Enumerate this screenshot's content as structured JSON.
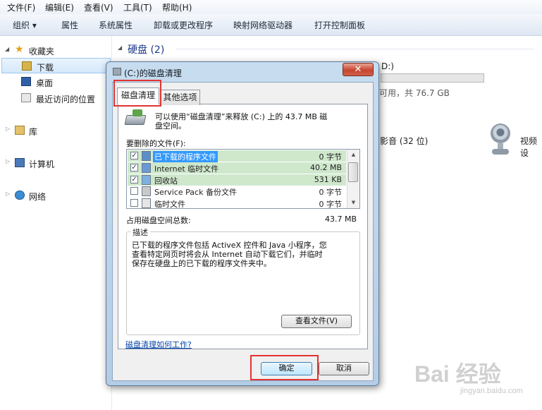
{
  "menubar": {
    "items": [
      "文件(F)",
      "编辑(E)",
      "查看(V)",
      "工具(T)",
      "帮助(H)"
    ]
  },
  "toolbar": {
    "items": [
      "组织 ▾",
      "属性",
      "系统属性",
      "卸载或更改程序",
      "映射网络驱动器",
      "打开控制面板"
    ]
  },
  "nav": {
    "favorites": "收藏夹",
    "downloads": "下载",
    "desktop": "桌面",
    "recent": "最近访问的位置",
    "libraries": "库",
    "computer": "计算机",
    "network": "网络"
  },
  "content": {
    "section_title": "硬盘 (2)",
    "drive_d_label": "D:)",
    "drive_d_space": "可用，共 76.7 GB",
    "music_label": "影音 (32 位)",
    "video_label": "视频设"
  },
  "dialog": {
    "title": "(C:)的磁盘清理",
    "close_symbol": "✕",
    "tabs": [
      "磁盘清理",
      "其他选项"
    ],
    "intro": "可以使用“磁盘清理”来释放  (C:) 上的 43.7 MB 磁",
    "intro_line2": "盘空间。",
    "files_label": "要删除的文件(F):",
    "files": [
      {
        "name": "已下载的程序文件",
        "size": "0 字节",
        "checked": true
      },
      {
        "name": "Internet 临时文件",
        "size": "40.2 MB",
        "checked": true
      },
      {
        "name": "回收站",
        "size": "531 KB",
        "checked": true
      },
      {
        "name": "Service Pack 备份文件",
        "size": "0 字节",
        "checked": false
      },
      {
        "name": "临时文件",
        "size": "0 字节",
        "checked": false
      }
    ],
    "total_label": "占用磁盘空间总数:",
    "total_value": "43.7 MB",
    "desc_legend": "描述",
    "desc_lines": [
      "已下载的程序文件包括 ActiveX 控件和 Java 小程序，您",
      "查看特定网页时将会从 Internet 自动下载它们，并临时",
      "保存在硬盘上的已下载的程序文件夹中。"
    ],
    "view_files_button": "查看文件(V)",
    "help_link": "磁盘清理如何工作?",
    "ok_button": "确定",
    "cancel_button": "取消"
  },
  "watermark": {
    "brand": "Bai 经验",
    "url": "jingyan.baidu.com"
  },
  "colors": {
    "highlight_red": "#e23333",
    "checked_row": "#cfe8cc",
    "selection": "#3399ff"
  }
}
